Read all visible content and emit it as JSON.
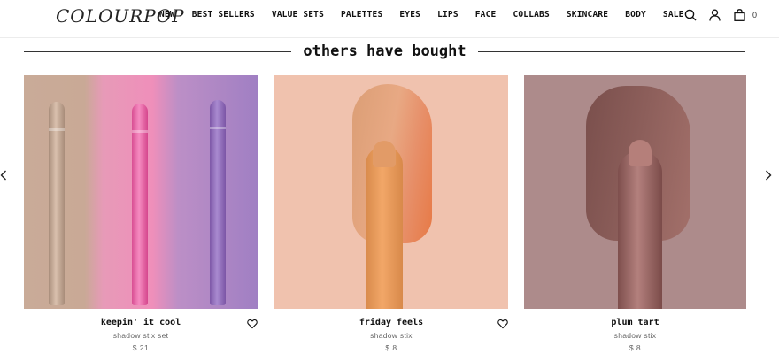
{
  "header": {
    "logo": "COLOURPOP",
    "nav": [
      "NEW",
      "BEST SELLERS",
      "VALUE SETS",
      "PALETTES",
      "EYES",
      "LIPS",
      "FACE",
      "COLLABS",
      "SKINCARE",
      "BODY",
      "SALE"
    ],
    "cart_count": "0",
    "icons": [
      "search-icon",
      "account-icon",
      "bag-icon"
    ]
  },
  "section": {
    "title": "others have bought"
  },
  "carousel": {
    "left_icon": "chevron-left-icon",
    "right_icon": "chevron-right-icon"
  },
  "products": [
    {
      "name": "keepin' it cool",
      "subtitle": "shadow stix set",
      "price": "$ 21",
      "favorite_icon": "heart-icon",
      "swatch_colors": [
        "#c9ab98",
        "#ef8fba",
        "#a07fc3"
      ]
    },
    {
      "name": "friday feels",
      "subtitle": "shadow stix",
      "price": "$ 8",
      "favorite_icon": "heart-icon",
      "swatch_colors": [
        "#f0c2ae",
        "#f2a768"
      ]
    },
    {
      "name": "plum tart",
      "subtitle": "shadow stix",
      "price": "$ 8",
      "swatch_colors": [
        "#ad8b8b",
        "#8d5f5b"
      ]
    }
  ]
}
